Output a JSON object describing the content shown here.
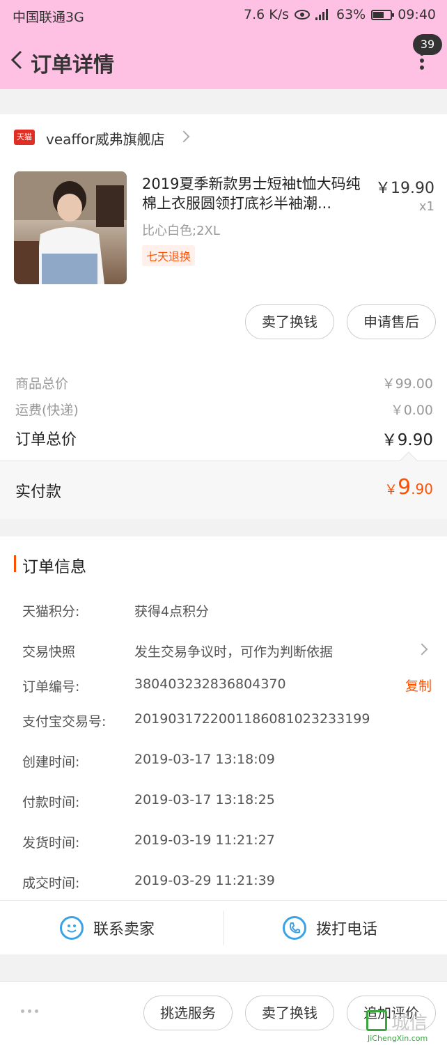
{
  "status_bar": {
    "carrier": "中国联通3G",
    "speed": "7.6 K/s",
    "battery": "63%",
    "battery_level": 0.63,
    "time": "09:40"
  },
  "nav": {
    "title": "订单详情",
    "badge_count": "39"
  },
  "shop": {
    "badge": "天猫",
    "name": "veaffor威弗旗舰店"
  },
  "product": {
    "title": "2019夏季新款男士短袖t恤大码纯棉上衣服圆领打底衫半袖潮...",
    "price": "￥19.90",
    "qty": "x1",
    "sku": "比心白色;2XL",
    "tag": "七天退换"
  },
  "item_actions": {
    "sell": "卖了换钱",
    "after_sale": "申请售后"
  },
  "summary": {
    "goods_label": "商品总价",
    "goods_value": "￥99.00",
    "shipping_label": "运费(快递)",
    "shipping_value": "￥0.00",
    "total_label": "订单总价",
    "total_value": "￥9.90",
    "paid_label": "实付款",
    "paid_symbol": "￥",
    "paid_int": "9",
    "paid_dec": ".90"
  },
  "order_info": {
    "title": "订单信息",
    "rows": [
      {
        "label": "天猫积分:",
        "value": "获得4点积分"
      },
      {
        "label": "交易快照",
        "value": "发生交易争议时，可作为判断依据"
      },
      {
        "label": "订单编号:",
        "value": "380403232836804370"
      },
      {
        "label": "支付宝交易号:",
        "value": "2019031722001186081023233199"
      },
      {
        "label": "创建时间:",
        "value": "2019-03-17 13:18:09"
      },
      {
        "label": "付款时间:",
        "value": "2019-03-17 13:18:25"
      },
      {
        "label": "发货时间:",
        "value": "2019-03-19 11:21:27"
      },
      {
        "label": "成交时间:",
        "value": "2019-03-29 11:21:39"
      }
    ],
    "copy": "复制"
  },
  "contact": {
    "seller": "联系卖家",
    "phone": "拨打电话"
  },
  "bottom_actions": {
    "service": "挑选服务",
    "sell": "卖了换钱",
    "review": "追加评价"
  },
  "watermark": {
    "text": "城信",
    "sub": "JiChengXin.com"
  },
  "colors": {
    "header_bg": "#ffc1e3",
    "accent": "#ff5000",
    "icon_blue": "#3aa3e8"
  }
}
